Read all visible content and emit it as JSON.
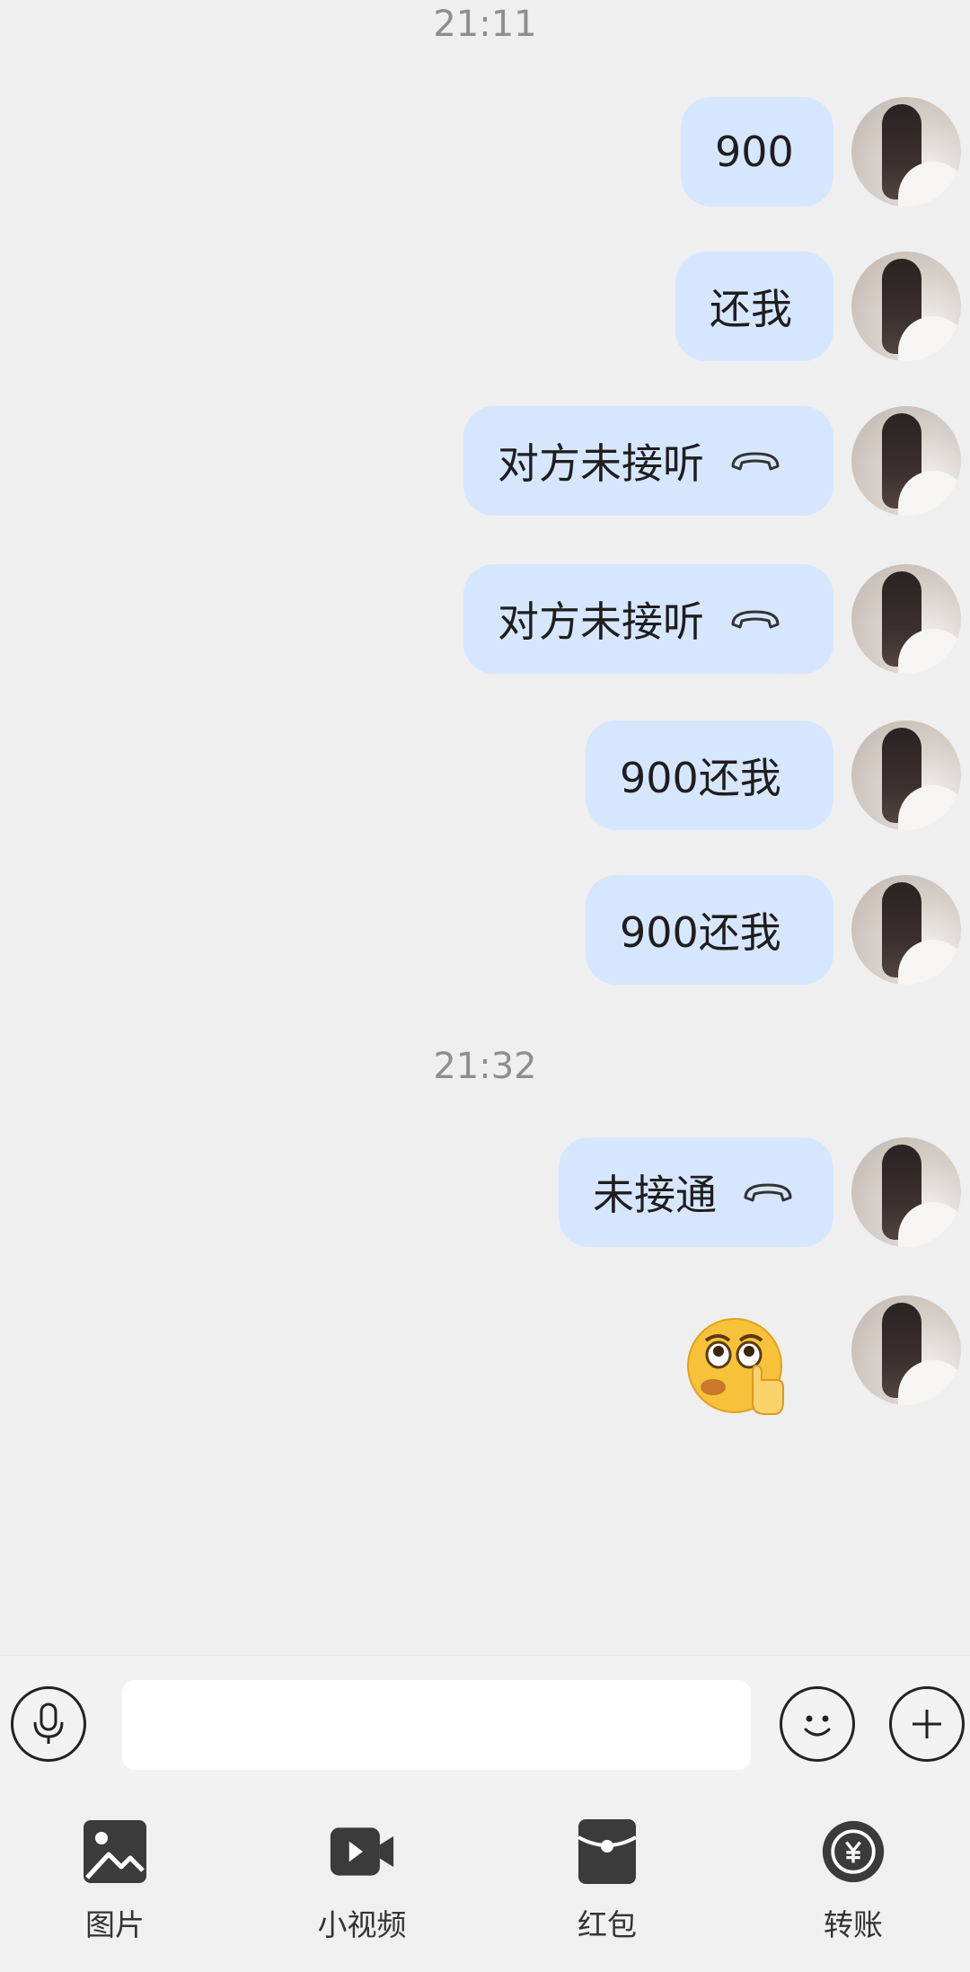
{
  "timestamps": [
    "21:11",
    "21:32"
  ],
  "messages": [
    {
      "text": "900",
      "call": false
    },
    {
      "text": "还我",
      "call": false
    },
    {
      "text": "对方未接听",
      "call": true
    },
    {
      "text": "对方未接听",
      "call": true
    },
    {
      "text": "900还我",
      "call": false
    },
    {
      "text": "900还我",
      "call": false
    },
    {
      "text": "未接通",
      "call": true
    }
  ],
  "sticker": "finger-nose emoji sticker",
  "input": {
    "value": "",
    "placeholder": ""
  },
  "tools": [
    {
      "label": "图片",
      "icon": "image-icon"
    },
    {
      "label": "小视频",
      "icon": "video-icon"
    },
    {
      "label": "红包",
      "icon": "red-packet-icon"
    },
    {
      "label": "转账",
      "icon": "transfer-icon"
    }
  ],
  "colors": {
    "bubble": "#d7e6ff",
    "background": "#efefef",
    "timestamp": "#8e8e8e"
  }
}
